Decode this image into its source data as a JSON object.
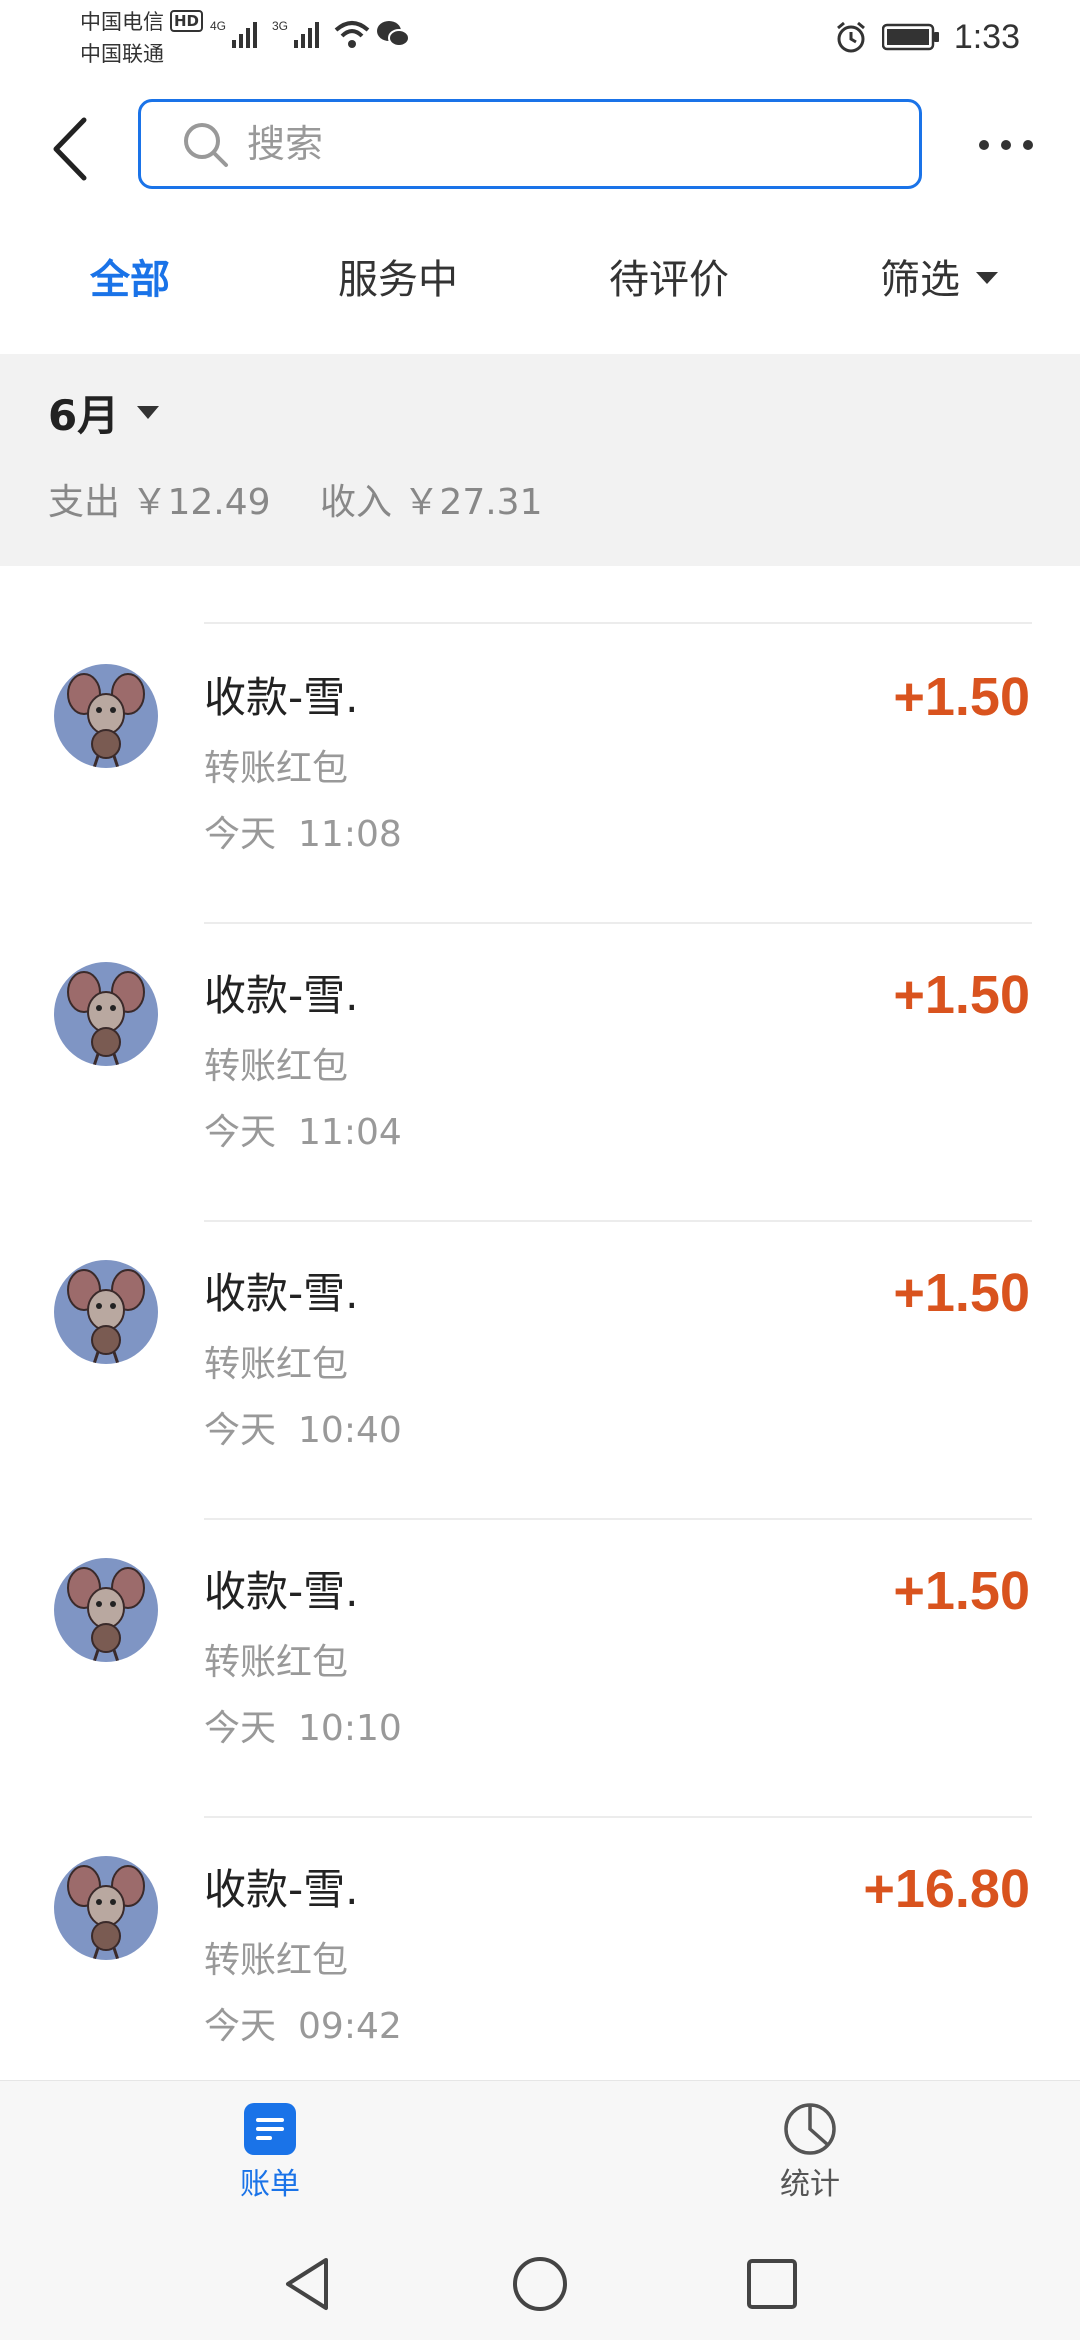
{
  "status_bar": {
    "carrier_1": "中国电信",
    "carrier_2": "中国联通",
    "hd_badge": "HD",
    "network_1": "4G",
    "network_2": "3G",
    "time": "1:33",
    "icons": [
      "signal-icon",
      "wifi-icon",
      "wechat-icon",
      "alarm-icon",
      "battery-icon"
    ]
  },
  "header": {
    "back_icon": "back-arrow-icon",
    "search_placeholder": "搜索",
    "more_icon": "more-dots-icon"
  },
  "tabs": [
    {
      "label": "全部",
      "active": true
    },
    {
      "label": "服务中",
      "active": false
    },
    {
      "label": "待评价",
      "active": false
    },
    {
      "label": "筛选",
      "active": false
    }
  ],
  "summary": {
    "month": "6月",
    "expense": "支出 ￥12.49",
    "income": "收入 ￥27.31"
  },
  "transactions": [
    {
      "title": "收款-雪.",
      "subtitle": "转账红包",
      "day": "今天",
      "time": "11:08",
      "amount": "+1.50"
    },
    {
      "title": "收款-雪.",
      "subtitle": "转账红包",
      "day": "今天",
      "time": "11:04",
      "amount": "+1.50"
    },
    {
      "title": "收款-雪.",
      "subtitle": "转账红包",
      "day": "今天",
      "time": "10:40",
      "amount": "+1.50"
    },
    {
      "title": "收款-雪.",
      "subtitle": "转账红包",
      "day": "今天",
      "time": "10:10",
      "amount": "+1.50"
    },
    {
      "title": "收款-雪.",
      "subtitle": "转账红包",
      "day": "今天",
      "time": "09:42",
      "amount": "+16.80"
    }
  ],
  "bottom_nav": [
    {
      "label": "账单",
      "icon": "bill-icon",
      "active": true
    },
    {
      "label": "统计",
      "icon": "pie-chart-icon",
      "active": false
    }
  ],
  "colors": {
    "accent": "#1a73e8",
    "amount": "#d9531e",
    "summary_bg": "#f2f2f2",
    "avatar_bg": "#7f95c4"
  }
}
